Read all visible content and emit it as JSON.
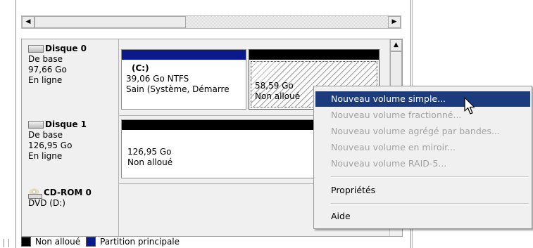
{
  "disks": [
    {
      "name": "Disque 0",
      "type": "De base",
      "size": "97,66 Go",
      "status": "En ligne",
      "partitions": [
        {
          "label": "(C:)",
          "size_fs": "39,06 Go NTFS",
          "status": "Sain (Système, Démarre"
        },
        {
          "size": "58,59 Go",
          "status": "Non alloué"
        }
      ]
    },
    {
      "name": "Disque 1",
      "type": "De base",
      "size": "126,95 Go",
      "status": "En ligne",
      "partitions": [
        {
          "size": "126,95 Go",
          "status": "Non alloué"
        }
      ]
    },
    {
      "name": "CD-ROM 0",
      "type": "DVD (D:)"
    }
  ],
  "context_menu": {
    "items": [
      {
        "label": "Nouveau volume simple...",
        "state": "highlighted"
      },
      {
        "label": "Nouveau volume fractionné...",
        "state": "disabled"
      },
      {
        "label": "Nouveau volume agrégé par bandes...",
        "state": "disabled"
      },
      {
        "label": "Nouveau volume en miroir...",
        "state": "disabled"
      },
      {
        "label": "Nouveau volume RAID-5...",
        "state": "disabled"
      },
      {
        "label": "Propriétés",
        "state": "enabled"
      },
      {
        "label": "Aide",
        "state": "enabled"
      }
    ]
  },
  "legend": [
    {
      "label": "Non alloué",
      "color": "#000000"
    },
    {
      "label": "Partition principale",
      "color": "#0a1a8c"
    }
  ],
  "colors": {
    "primary_partition": "#0a1a8c",
    "unallocated": "#000000",
    "menu_highlight": "#1b3b7d"
  }
}
